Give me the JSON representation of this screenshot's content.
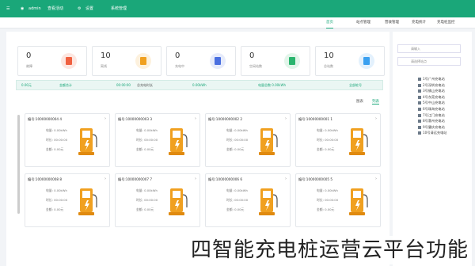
{
  "topbar": {
    "menu_icon": "menu-icon",
    "items": [
      "admin",
      "查看活动",
      "设置",
      "系统管理"
    ]
  },
  "tabs": [
    "首页",
    "站点管理",
    "营收管理",
    "充电统计",
    "充电桩监控",
    "首页"
  ],
  "stats": [
    {
      "value": "10",
      "label": "总站数",
      "color": "#3aa0f0"
    },
    {
      "value": "0",
      "label": "空闲站数",
      "color": "#2ab56e"
    },
    {
      "value": "0",
      "label": "充电中",
      "color": "#4a6fe0"
    },
    {
      "value": "10",
      "label": "离线",
      "color": "#f0a020"
    },
    {
      "value": "0",
      "label": "故障",
      "color": "#f06040"
    }
  ],
  "infobar": [
    "全部桩号",
    "电量总数 0.00kWh",
    "总充电时长",
    "00:00:00",
    "总充电量",
    "0.00kWh",
    "金额合计",
    "0.00元"
  ],
  "subtabs": [
    "列表",
    "图表"
  ],
  "cards": [
    {
      "title": "编号:10000000001 1",
      "rows": [
        "电量: 0.00kWh",
        "时长: 00:00:00",
        "金额: 0.00元"
      ]
    },
    {
      "title": "编号:10000000002 2",
      "rows": [
        "电量: 0.00kWh",
        "时长: 00:00:00",
        "金额: 0.00元"
      ]
    },
    {
      "title": "编号:10000000003 3",
      "rows": [
        "电量: 0.00kWh",
        "时长: 00:00:00",
        "金额: 0.00元"
      ]
    },
    {
      "title": "编号:10000000004 4",
      "rows": [
        "电量: 0.00kWh",
        "时长: 00:00:00",
        "金额: 0.00元"
      ]
    },
    {
      "title": "编号:10000000005 5",
      "rows": [
        "电量: 0.00kWh",
        "时长: 00:00:00",
        "金额: 0.00元"
      ]
    },
    {
      "title": "编号:10000000006 6",
      "rows": [
        "电量: 0.00kWh",
        "时长: 00:00:00",
        "金额: 0.00元"
      ]
    },
    {
      "title": "编号:10000000007 7",
      "rows": [
        "电量: 0.00kWh",
        "时长: 00:00:00",
        "金额: 0.00元"
      ]
    },
    {
      "title": "编号:10000000008 8",
      "rows": [
        "电量: 0.00kWh",
        "时长: 00:00:00",
        "金额: 0.00元"
      ]
    }
  ],
  "sidebar": {
    "search_placeholder": "请输入",
    "filter_placeholder": "请选择站点",
    "tree": [
      "1号广州充电站",
      "2号深圳充电站",
      "3号佛山充电站",
      "4号东莞充电站",
      "5号中山充电站",
      "6号珠海充电站",
      "7号江门充电站",
      "8号惠州充电站",
      "9号肇庆充电站",
      "10号清远充电站"
    ]
  },
  "caption": "四智能充电桩运营云平台功能"
}
